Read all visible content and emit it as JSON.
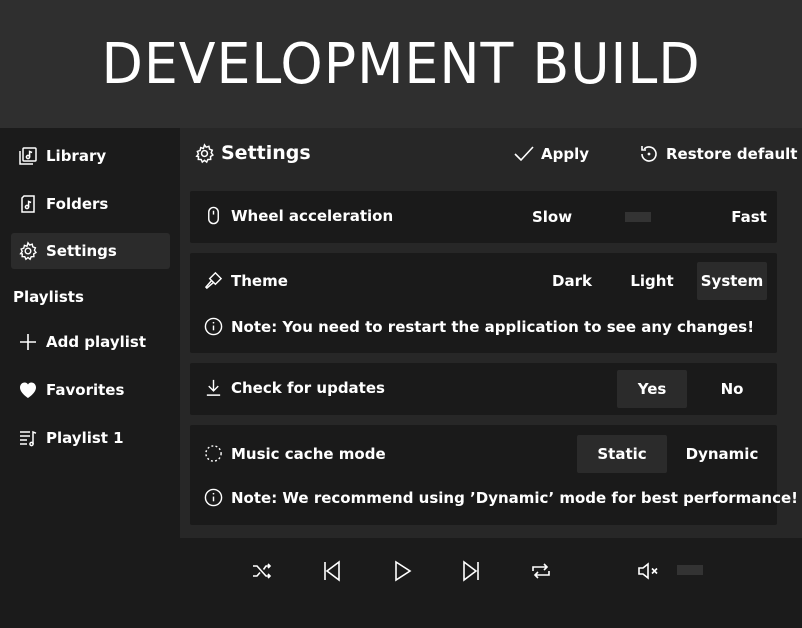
{
  "banner": {
    "text": "DEVELOPMENT BUILD"
  },
  "sidebar": {
    "items": [
      {
        "label": "Library",
        "icon": "library-icon"
      },
      {
        "label": "Folders",
        "icon": "folder-music-icon"
      },
      {
        "label": "Settings",
        "icon": "gear-icon",
        "active": true
      }
    ],
    "playlists_heading": "Playlists",
    "playlists": [
      {
        "label": "Add playlist",
        "icon": "plus-icon"
      },
      {
        "label": "Favorites",
        "icon": "heart-icon"
      },
      {
        "label": "Playlist 1",
        "icon": "playlist-icon"
      }
    ]
  },
  "header": {
    "title": "Settings",
    "apply_label": "Apply",
    "restore_label": "Restore default"
  },
  "settings": {
    "wheel": {
      "label": "Wheel acceleration",
      "min_label": "Slow",
      "max_label": "Fast"
    },
    "theme": {
      "label": "Theme",
      "options": [
        "Dark",
        "Light",
        "System"
      ],
      "selected": "System",
      "note": "Note: You need to restart the application to see any changes!"
    },
    "updates": {
      "label": "Check for updates",
      "options": [
        "Yes",
        "No"
      ],
      "selected": "Yes"
    },
    "cache": {
      "label": "Music cache mode",
      "options": [
        "Static",
        "Dynamic"
      ],
      "selected": "Static",
      "note": "Note: We recommend using ’Dynamic’ mode for best performance!"
    }
  },
  "player": {
    "controls": [
      "shuffle-icon",
      "skip-previous-icon",
      "play-icon",
      "skip-next-icon",
      "repeat-icon",
      "mute-icon"
    ]
  },
  "colors": {
    "background": "#1b1b1b",
    "panel": "#272727",
    "card": "#1a1a1a",
    "selected": "#2b2b2b",
    "banner": "#2f2f2f"
  }
}
